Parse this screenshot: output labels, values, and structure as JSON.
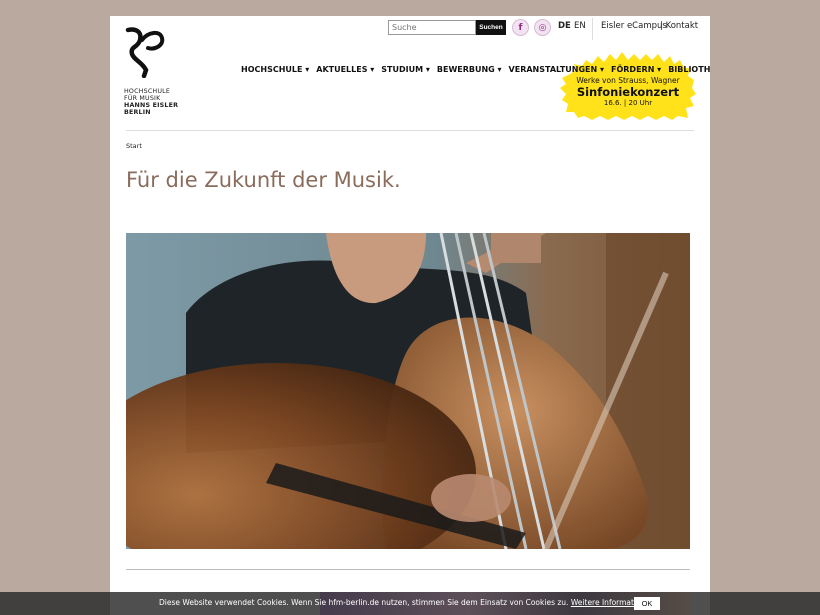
{
  "header": {
    "logo_lines": [
      "HOCHSCHULE",
      "FÜR MUSIK",
      "HANNS EISLER",
      "BERLIN"
    ],
    "search_placeholder": "Suche",
    "search_button": "Suchen",
    "social": {
      "facebook": "f",
      "instagram": "◎"
    },
    "languages": {
      "de": "DE",
      "en": "EN"
    },
    "top_links": {
      "ecampus": "Eisler eCampus",
      "kontakt": "| Kontakt"
    }
  },
  "nav": {
    "items": [
      {
        "label": "HOCHSCHULE ▾"
      },
      {
        "label": "AKTUELLES ▾"
      },
      {
        "label": "STUDIUM ▾"
      },
      {
        "label": "BEWERBUNG ▾"
      },
      {
        "label": "VERANSTALTUNGEN ▾"
      },
      {
        "label": "FÖRDERN ▾"
      },
      {
        "label": "BIBLIOTHEK ▾"
      }
    ]
  },
  "promo": {
    "line1": "Werke von Strauss, Wagner",
    "title": "Sinfoniekonzert",
    "date": "16.6. | 20 Uhr",
    "color": "#ffe21a"
  },
  "breadcrumb": "Start",
  "page_title": "Für die Zukunft der Musik.",
  "cookie": {
    "text": "Diese Website verwendet Cookies. Wenn Sie hfm-berlin.de nutzen, stimmen Sie dem Einsatz von Cookies zu.",
    "link": "Weitere Informationen",
    "ok": "OK"
  },
  "colors": {
    "background": "#b9a99e",
    "title": "#8a6c5d",
    "accent": "#8e2b86"
  }
}
